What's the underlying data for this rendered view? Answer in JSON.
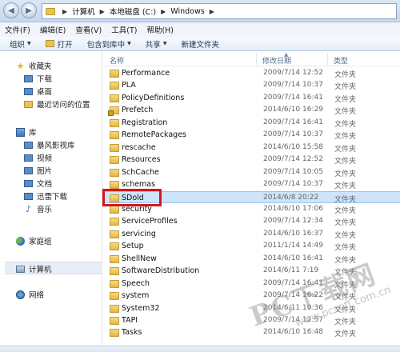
{
  "address": {
    "crumbs": [
      "计算机",
      "本地磁盘 (C:)",
      "Windows"
    ]
  },
  "menu": [
    "文件(F)",
    "编辑(E)",
    "查看(V)",
    "工具(T)",
    "帮助(H)"
  ],
  "toolbar": {
    "organize": "组织",
    "open": "打开",
    "include_library": "包含到库中",
    "share": "共享",
    "new_folder": "新建文件夹"
  },
  "sidebar": {
    "favorites": "收藏夹",
    "downloads": "下载",
    "desktop": "桌面",
    "recent": "最近访问的位置",
    "libraries": "库",
    "storm_video": "暴风影视库",
    "videos": "视频",
    "pictures": "图片",
    "documents": "文档",
    "thunder": "迅雷下载",
    "music": "音乐",
    "homegroup": "家庭组",
    "computer": "计算机",
    "network": "网络"
  },
  "columns": {
    "name": "名称",
    "date": "修改日期",
    "type": "类型"
  },
  "files": [
    {
      "name": "Performance",
      "date": "2009/7/14 12:52",
      "type": "文件夹"
    },
    {
      "name": "PLA",
      "date": "2009/7/14 10:37",
      "type": "文件夹"
    },
    {
      "name": "PolicyDefinitions",
      "date": "2009/7/14 16:41",
      "type": "文件夹"
    },
    {
      "name": "Prefetch",
      "date": "2014/6/10 16:29",
      "type": "文件夹",
      "locked": true
    },
    {
      "name": "Registration",
      "date": "2009/7/14 16:41",
      "type": "文件夹"
    },
    {
      "name": "RemotePackages",
      "date": "2009/7/14 10:37",
      "type": "文件夹"
    },
    {
      "name": "rescache",
      "date": "2014/6/10 15:58",
      "type": "文件夹"
    },
    {
      "name": "Resources",
      "date": "2009/7/14 12:52",
      "type": "文件夹"
    },
    {
      "name": "SchCache",
      "date": "2009/7/14 10:05",
      "type": "文件夹"
    },
    {
      "name": "schemas",
      "date": "2009/7/14 10:37",
      "type": "文件夹"
    },
    {
      "name": "SDold",
      "date": "2014/6/8 20:22",
      "type": "文件夹",
      "selected": true
    },
    {
      "name": "security",
      "date": "2014/6/10 17:06",
      "type": "文件夹"
    },
    {
      "name": "ServiceProfiles",
      "date": "2009/7/14 12:34",
      "type": "文件夹"
    },
    {
      "name": "servicing",
      "date": "2014/6/10 16:37",
      "type": "文件夹"
    },
    {
      "name": "Setup",
      "date": "2011/1/14 14:49",
      "type": "文件夹"
    },
    {
      "name": "ShellNew",
      "date": "2014/6/10 16:41",
      "type": "文件夹"
    },
    {
      "name": "SoftwareDistribution",
      "date": "2014/6/11 7:19",
      "type": "文件夹"
    },
    {
      "name": "Speech",
      "date": "2009/7/14 16:41",
      "type": "文件夹"
    },
    {
      "name": "system",
      "date": "2009/7/14 16:22",
      "type": "文件夹"
    },
    {
      "name": "System32",
      "date": "2014/6/11 10:36",
      "type": "文件夹"
    },
    {
      "name": "TAPI",
      "date": "2009/7/14 12:57",
      "type": "文件夹"
    },
    {
      "name": "Tasks",
      "date": "2014/6/10 16:48",
      "type": "文件夹"
    }
  ],
  "watermark": {
    "brand": "PC下载网",
    "url": "www.pcsoft.com.cn"
  },
  "colors": {
    "highlight_border": "#d0191b",
    "selection": "#cde4fb"
  }
}
